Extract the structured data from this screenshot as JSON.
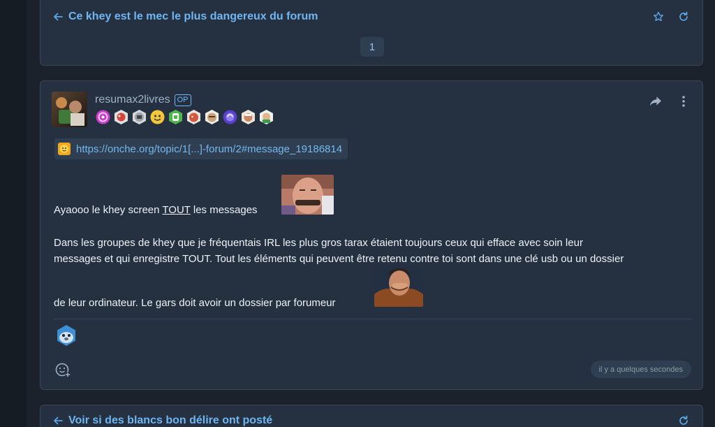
{
  "top_topic": {
    "title": "Ce khey est le mec le plus dangereux du forum",
    "current_page": "1"
  },
  "post": {
    "username": "resumax2livres",
    "op_label": "OP",
    "link_text": "https://onche.org/topic/1[...]-forum/2#message_19186814",
    "line1_before": "Ayaooo le khey screen ",
    "line1_underlined": "TOUT",
    "line1_after": " les messages",
    "line2": "Dans les groupes de khey que je fréquentais IRL les plus gros tarax étaient toujours ceux qui efface avec soin leur",
    "line3": "messages et qui enregistre TOUT. Tout les éléments qui peuvent être retenu contre toi sont dans une clé usb ou un dossier",
    "line4": "de leur ordinateur. Le gars doit avoir un dossier par forumeur",
    "timestamp": "il y a quelques secondes"
  },
  "bottom_topic": {
    "title": "Voir si des blancs bon délire ont posté"
  },
  "icons": [
    "arrow-left-icon",
    "star-icon",
    "refresh-icon",
    "share-icon",
    "more-vertical-icon",
    "add-reaction-icon"
  ],
  "colors": {
    "accent": "#6fb6f2",
    "card": "#253140",
    "background": "#1b222c"
  }
}
